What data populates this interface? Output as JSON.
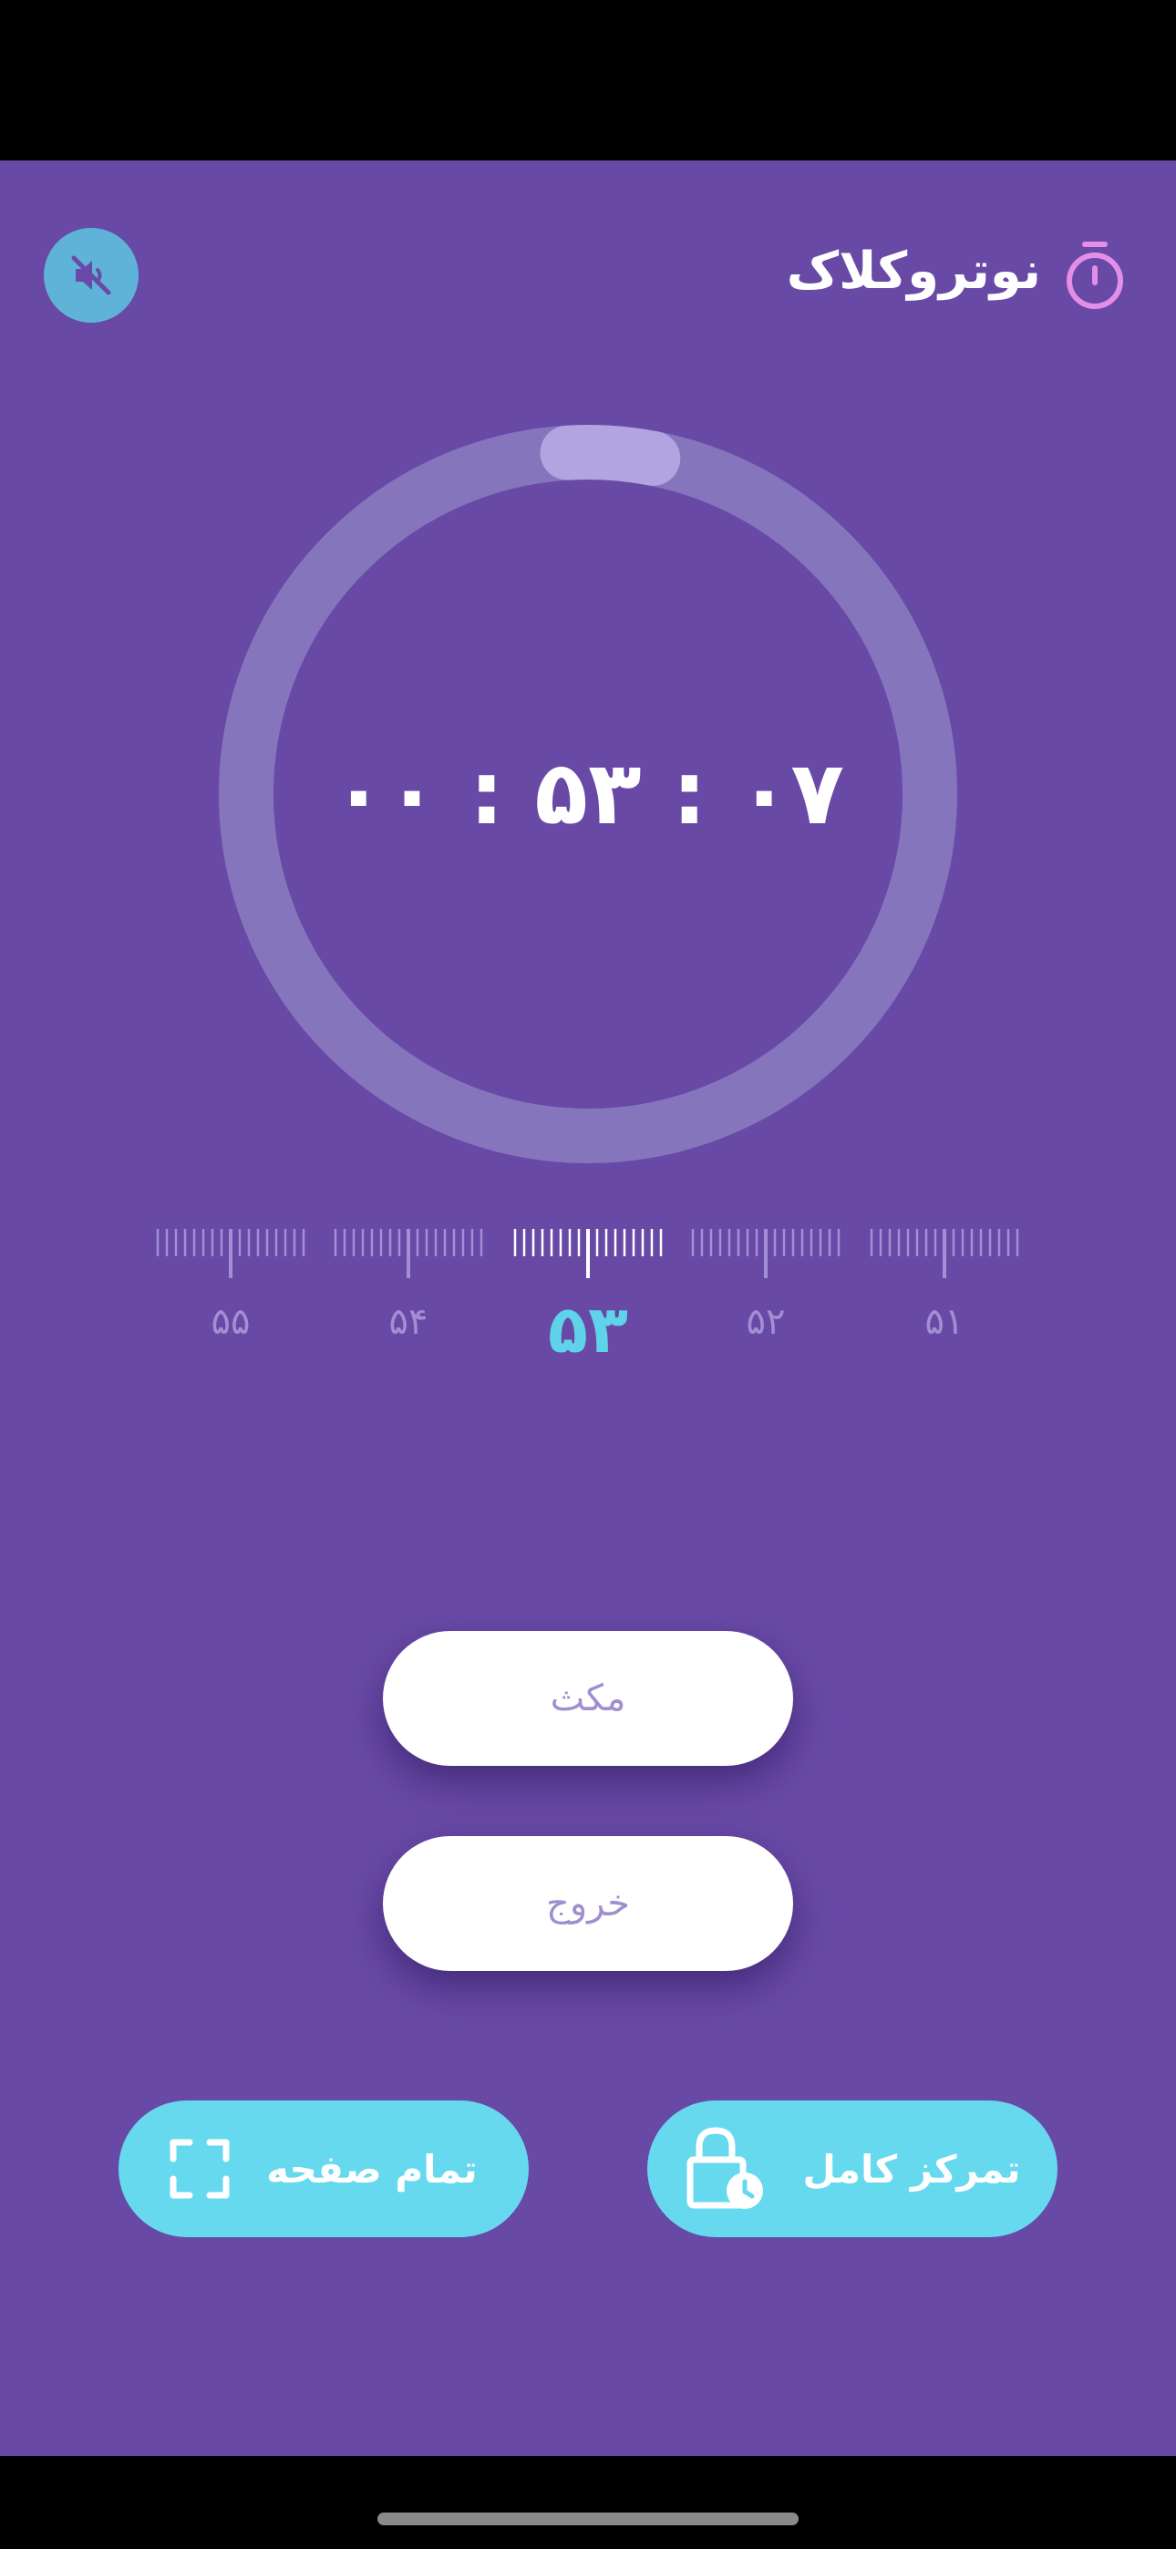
{
  "header": {
    "title": "نوتروکلاک",
    "title_icon": "stopwatch-icon",
    "mute_icon": "speaker-muted-icon"
  },
  "timer": {
    "display": "۰۰ : ۵۳ : ۰۷",
    "progress": 0.04
  },
  "ruler": {
    "labels": [
      "۵۵",
      "۵۴",
      "۵۳",
      "۵۲",
      "۵۱"
    ],
    "selected": "۵۳"
  },
  "actions": {
    "pause_label": "مکث",
    "exit_label": "خروج"
  },
  "footer": {
    "fullscreen_label": "تمام صفحه",
    "fullscreen_icon": "fullscreen-icon",
    "focus_label": "تمرکز کامل",
    "focus_icon": "lock-clock-icon"
  },
  "colors": {
    "background": "#6849a6",
    "accent_cyan": "#67d9ef",
    "mute_button": "#5fb3d9",
    "title_icon": "#e58ee6"
  }
}
